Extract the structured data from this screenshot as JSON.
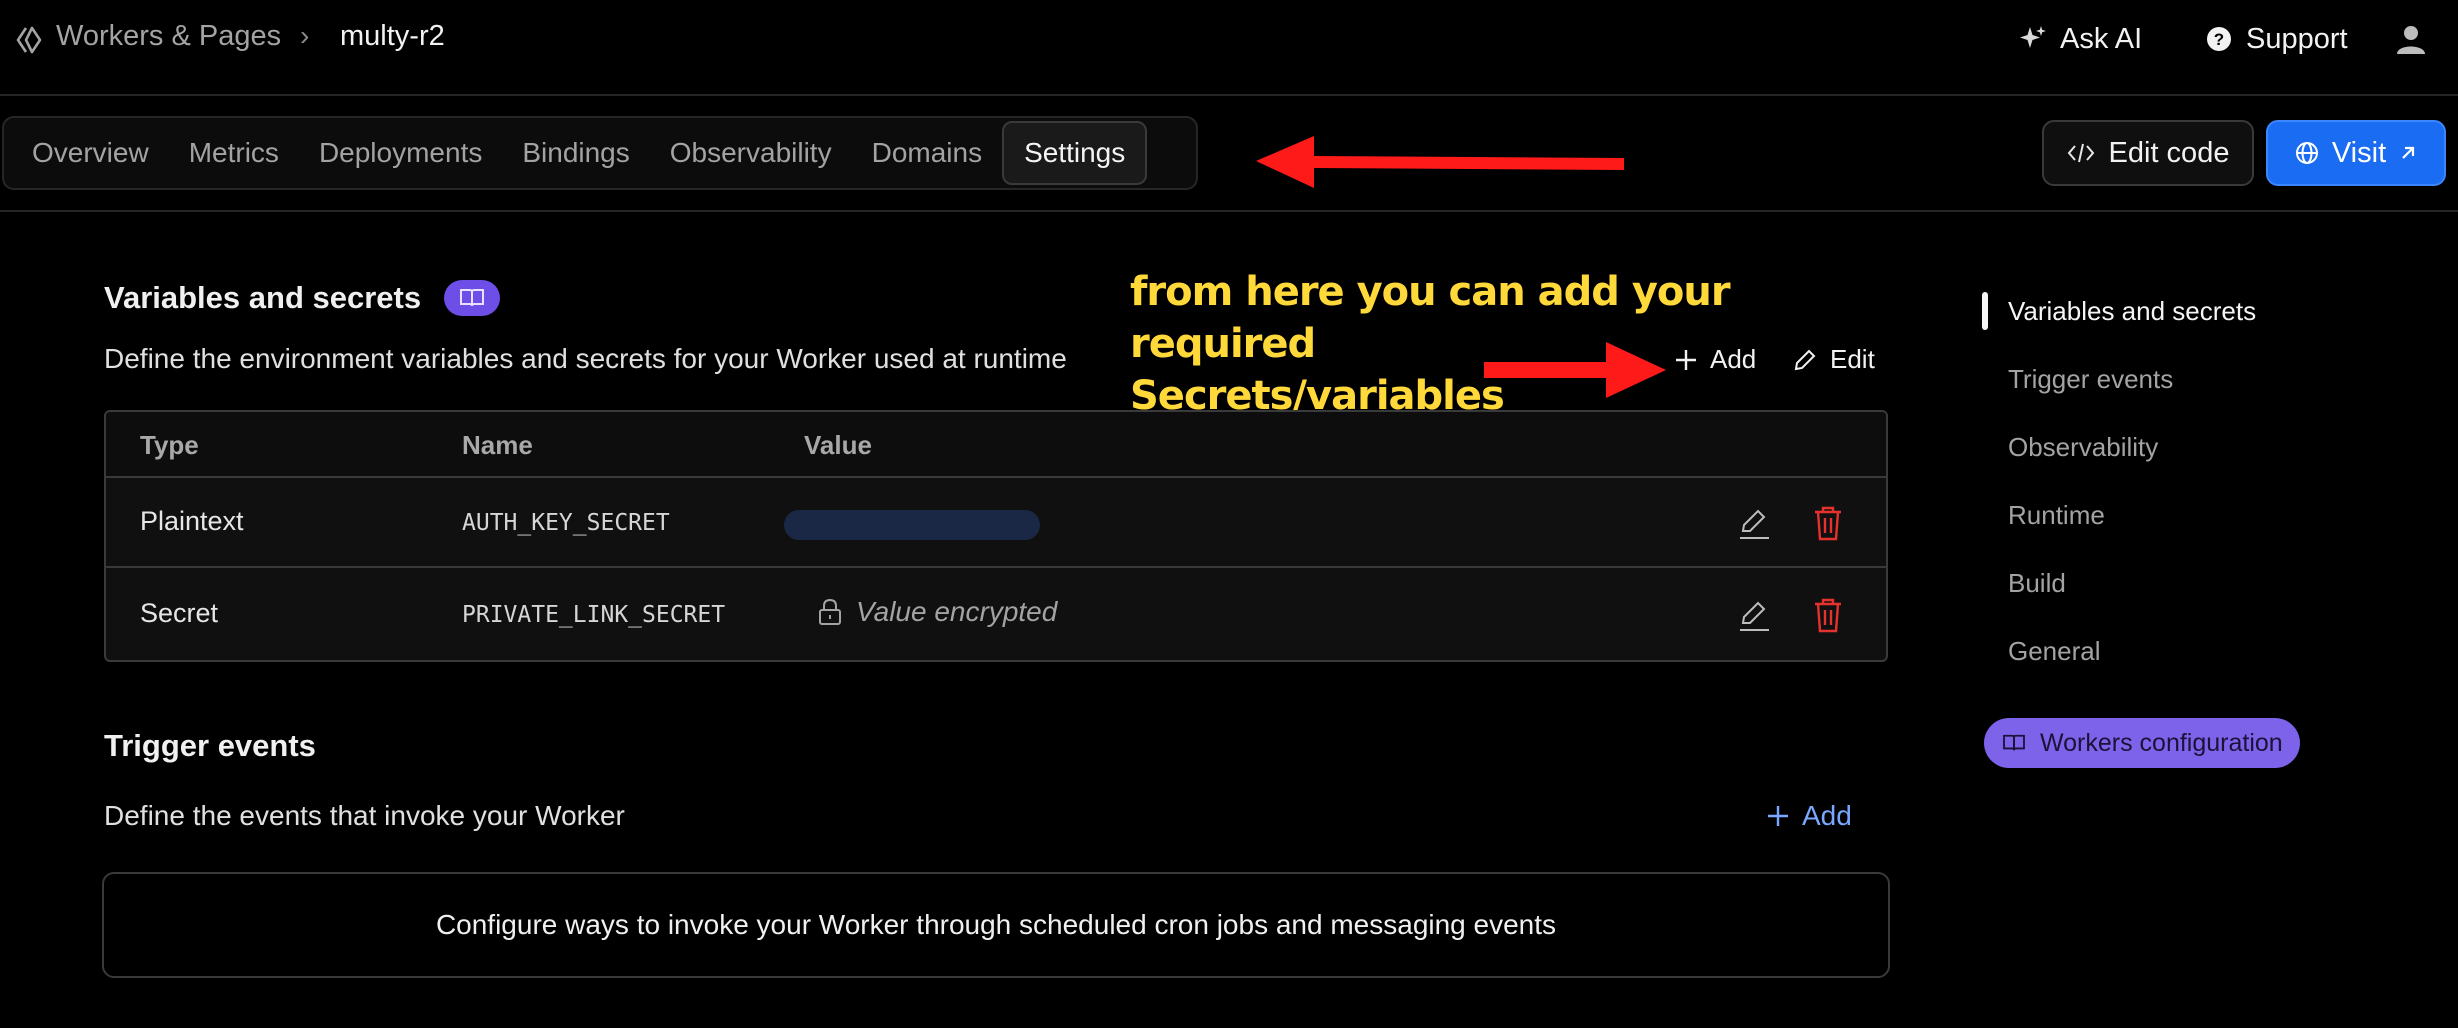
{
  "breadcrumb": {
    "root": "Workers & Pages",
    "separator": "›",
    "current": "multy-r2"
  },
  "header_actions": {
    "ask_ai": "Ask AI",
    "support": "Support"
  },
  "tabs": [
    {
      "label": "Overview"
    },
    {
      "label": "Metrics"
    },
    {
      "label": "Deployments"
    },
    {
      "label": "Bindings"
    },
    {
      "label": "Observability"
    },
    {
      "label": "Domains"
    },
    {
      "label": "Settings",
      "active": true
    }
  ],
  "toolbar": {
    "edit_code": "Edit code",
    "visit": "Visit"
  },
  "annotation": {
    "line1": "from here you can add your required",
    "line2": "Secrets/variables"
  },
  "variables": {
    "title": "Variables and secrets",
    "description": "Define the environment variables and secrets for your Worker used at runtime",
    "add_label": "Add",
    "edit_label": "Edit",
    "columns": [
      "Type",
      "Name",
      "Value"
    ],
    "rows": [
      {
        "type": "Plaintext",
        "name": "AUTH_KEY_SECRET",
        "value_masked": true
      },
      {
        "type": "Secret",
        "name": "PRIVATE_LINK_SECRET",
        "value": "Value encrypted"
      }
    ]
  },
  "triggers": {
    "title": "Trigger events",
    "description": "Define the events that invoke your Worker",
    "add_label": "Add",
    "empty_text": "Configure ways to invoke your Worker through scheduled cron jobs and messaging events"
  },
  "right_nav": {
    "items": [
      "Variables and secrets",
      "Trigger events",
      "Observability",
      "Runtime",
      "Build",
      "General"
    ],
    "active": "Variables and secrets",
    "config_link": "Workers configuration"
  },
  "colors": {
    "accent_blue": "#1a6cf2",
    "badge_purple": "#7d63ea",
    "annotation_red": "#ff1a1a",
    "annotation_yellow": "#ffd83a",
    "delete_red": "#e5322d"
  }
}
